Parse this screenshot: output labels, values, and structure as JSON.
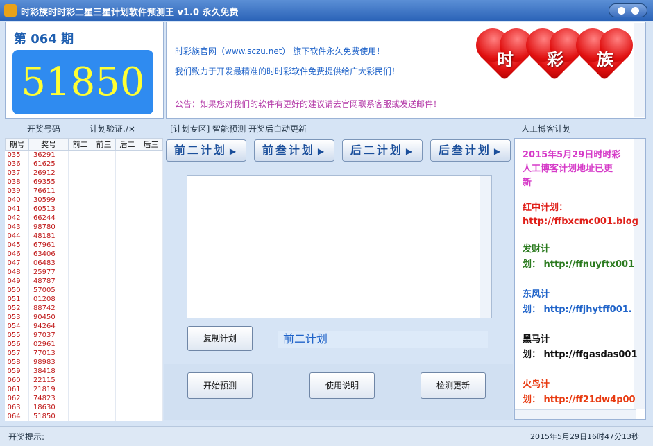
{
  "window": {
    "title": "时彩族时时彩二星三星计划软件预测王 v1.0 永久免费"
  },
  "issue": {
    "label": "第 064 期",
    "number": "51850"
  },
  "notice": {
    "line1": "时彩族官网（www.sczu.net） 旗下软件永久免费使用！",
    "line2": "我们致力于开发最精准的时时彩软件免费提供给广大彩民们！",
    "line3": "公告：如果您对我们的软件有更好的建议请去官网联系客服或发送邮件！",
    "hearts": [
      "时",
      "彩",
      "族"
    ]
  },
  "history": {
    "group_title1": "开奖号码",
    "group_title2": "计划验证./×",
    "columns": [
      "期号",
      "奖号",
      "前二",
      "前三",
      "后二",
      "后三"
    ],
    "rows": [
      [
        "035",
        "36291"
      ],
      [
        "036",
        "61625"
      ],
      [
        "037",
        "26912"
      ],
      [
        "038",
        "69355"
      ],
      [
        "039",
        "76611"
      ],
      [
        "040",
        "30599"
      ],
      [
        "041",
        "60513"
      ],
      [
        "042",
        "66244"
      ],
      [
        "043",
        "98780"
      ],
      [
        "044",
        "48181"
      ],
      [
        "045",
        "67961"
      ],
      [
        "046",
        "63406"
      ],
      [
        "047",
        "06483"
      ],
      [
        "048",
        "25977"
      ],
      [
        "049",
        "48787"
      ],
      [
        "050",
        "57005"
      ],
      [
        "051",
        "01208"
      ],
      [
        "052",
        "88742"
      ],
      [
        "053",
        "90450"
      ],
      [
        "054",
        "94264"
      ],
      [
        "055",
        "97037"
      ],
      [
        "056",
        "02961"
      ],
      [
        "057",
        "77013"
      ],
      [
        "058",
        "98983"
      ],
      [
        "059",
        "38418"
      ],
      [
        "060",
        "22115"
      ],
      [
        "061",
        "21819"
      ],
      [
        "062",
        "74823"
      ],
      [
        "063",
        "18630"
      ],
      [
        "064",
        "51850"
      ]
    ]
  },
  "center": {
    "title": "[计划专区] 智能预测 开奖后自动更新",
    "plan_buttons": [
      "前二计划",
      "前叁计划",
      "后二计划",
      "后叁计划"
    ],
    "copy_label": "复制计划",
    "current_plan": "前二计划",
    "start_label": "开始预测",
    "help_label": "使用说明",
    "update_label": "检测更新"
  },
  "blog": {
    "title": "人工博客计划",
    "entries": [
      {
        "text": "2015年5月29日时时彩",
        "color": "#d63bc8"
      },
      {
        "text": "人工博客计划地址已更",
        "color": "#d63bc8"
      },
      {
        "text": "新",
        "color": "#d63bc8"
      },
      {
        "text": "红中计划：",
        "color": "#e0201a"
      },
      {
        "text": "http://ffbxcmc001.blog",
        "color": "#e0201a"
      },
      {
        "text": "发财计",
        "color": "#2a7a1e"
      },
      {
        "text": "划：  http://ffnuyftx001",
        "color": "#2a7a1e"
      },
      {
        "text": "东风计",
        "color": "#1f63c9"
      },
      {
        "text": "划：  http://ffjhytff001.",
        "color": "#1f63c9"
      },
      {
        "text": "黑马计",
        "color": "#111111"
      },
      {
        "text": "划：  http://ffgasdas001",
        "color": "#111111"
      },
      {
        "text": "火鸟计",
        "color": "#e83a10"
      },
      {
        "text": "划：  http://ff21dw4p00",
        "color": "#e83a10"
      }
    ]
  },
  "status": {
    "left": "开奖提示:",
    "right": "2015年5月29日16时47分13秒"
  }
}
